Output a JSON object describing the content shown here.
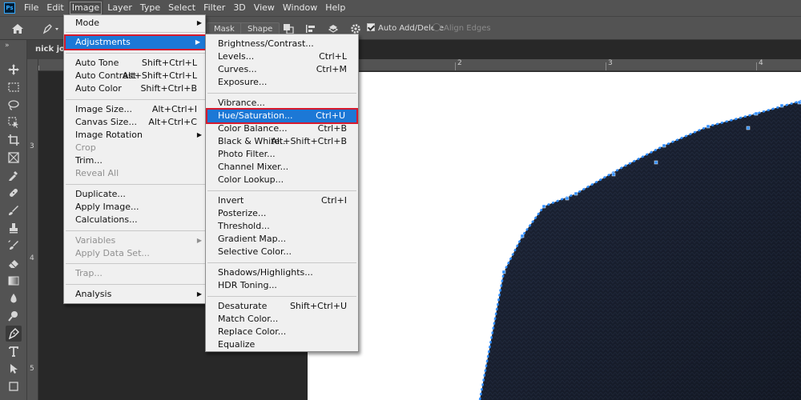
{
  "menubar": {
    "logo": "Ps",
    "items": [
      "File",
      "Edit",
      "Image",
      "Layer",
      "Type",
      "Select",
      "Filter",
      "3D",
      "View",
      "Window",
      "Help"
    ]
  },
  "options": {
    "mask_label": "Mask",
    "shape_label": "Shape",
    "auto_add_delete_label": "Auto Add/Delete",
    "auto_add_delete_checked": true,
    "align_edges_label": "Align Edges",
    "align_edges_checked": false
  },
  "tool_panel": {
    "collapse_glyph": "»",
    "tools": [
      "move-tool",
      "marquee-tool",
      "lasso-tool",
      "object-select-tool",
      "crop-tool",
      "frame-tool",
      "eyedropper-tool",
      "healing-brush-tool",
      "brush-tool",
      "clone-stamp-tool",
      "history-brush-tool",
      "eraser-tool",
      "gradient-tool",
      "blur-tool",
      "dodge-tool",
      "pen-tool",
      "type-tool",
      "path-select-tool",
      "shape-tool"
    ],
    "selected_tool": "pen-tool"
  },
  "document": {
    "tab_title": "nick joi",
    "ruler_top_numbers": [
      "1",
      "2",
      "3",
      "4"
    ],
    "ruler_left_numbers": [
      "3",
      "4",
      "5"
    ]
  },
  "image_menu": {
    "items": [
      {
        "label": "Mode",
        "submenu": true
      },
      {
        "label": "Adjustments",
        "submenu": true,
        "highlighted": true
      },
      {
        "label": "Auto Tone",
        "shortcut": "Shift+Ctrl+L"
      },
      {
        "label": "Auto Contrast",
        "shortcut": "Alt+Shift+Ctrl+L"
      },
      {
        "label": "Auto Color",
        "shortcut": "Shift+Ctrl+B"
      },
      {
        "label": "Image Size...",
        "shortcut": "Alt+Ctrl+I"
      },
      {
        "label": "Canvas Size...",
        "shortcut": "Alt+Ctrl+C"
      },
      {
        "label": "Image Rotation",
        "submenu": true
      },
      {
        "label": "Crop",
        "disabled": true
      },
      {
        "label": "Trim..."
      },
      {
        "label": "Reveal All",
        "disabled": true
      },
      {
        "label": "Duplicate..."
      },
      {
        "label": "Apply Image..."
      },
      {
        "label": "Calculations..."
      },
      {
        "label": "Variables",
        "submenu": true,
        "disabled": true
      },
      {
        "label": "Apply Data Set...",
        "disabled": true
      },
      {
        "label": "Trap...",
        "disabled": true
      },
      {
        "label": "Analysis",
        "submenu": true
      }
    ]
  },
  "adjustments_menu": {
    "items": [
      {
        "label": "Brightness/Contrast..."
      },
      {
        "label": "Levels...",
        "shortcut": "Ctrl+L"
      },
      {
        "label": "Curves...",
        "shortcut": "Ctrl+M"
      },
      {
        "label": "Exposure..."
      },
      {
        "label": "Vibrance..."
      },
      {
        "label": "Hue/Saturation...",
        "shortcut": "Ctrl+U",
        "highlighted": true
      },
      {
        "label": "Color Balance...",
        "shortcut": "Ctrl+B"
      },
      {
        "label": "Black & White...",
        "shortcut": "Alt+Shift+Ctrl+B"
      },
      {
        "label": "Photo Filter..."
      },
      {
        "label": "Channel Mixer..."
      },
      {
        "label": "Color Lookup..."
      },
      {
        "label": "Invert",
        "shortcut": "Ctrl+I"
      },
      {
        "label": "Posterize..."
      },
      {
        "label": "Threshold..."
      },
      {
        "label": "Gradient Map..."
      },
      {
        "label": "Selective Color..."
      },
      {
        "label": "Shadows/Highlights..."
      },
      {
        "label": "HDR Toning..."
      },
      {
        "label": "Desaturate",
        "shortcut": "Shift+Ctrl+U"
      },
      {
        "label": "Match Color..."
      },
      {
        "label": "Replace Color..."
      },
      {
        "label": "Equalize"
      }
    ]
  },
  "colors": {
    "menu_highlight": "#1c78d6",
    "highlight_outline": "#d7192d",
    "path_anchor": "#2d8cff",
    "sweater": "#1c2436"
  }
}
